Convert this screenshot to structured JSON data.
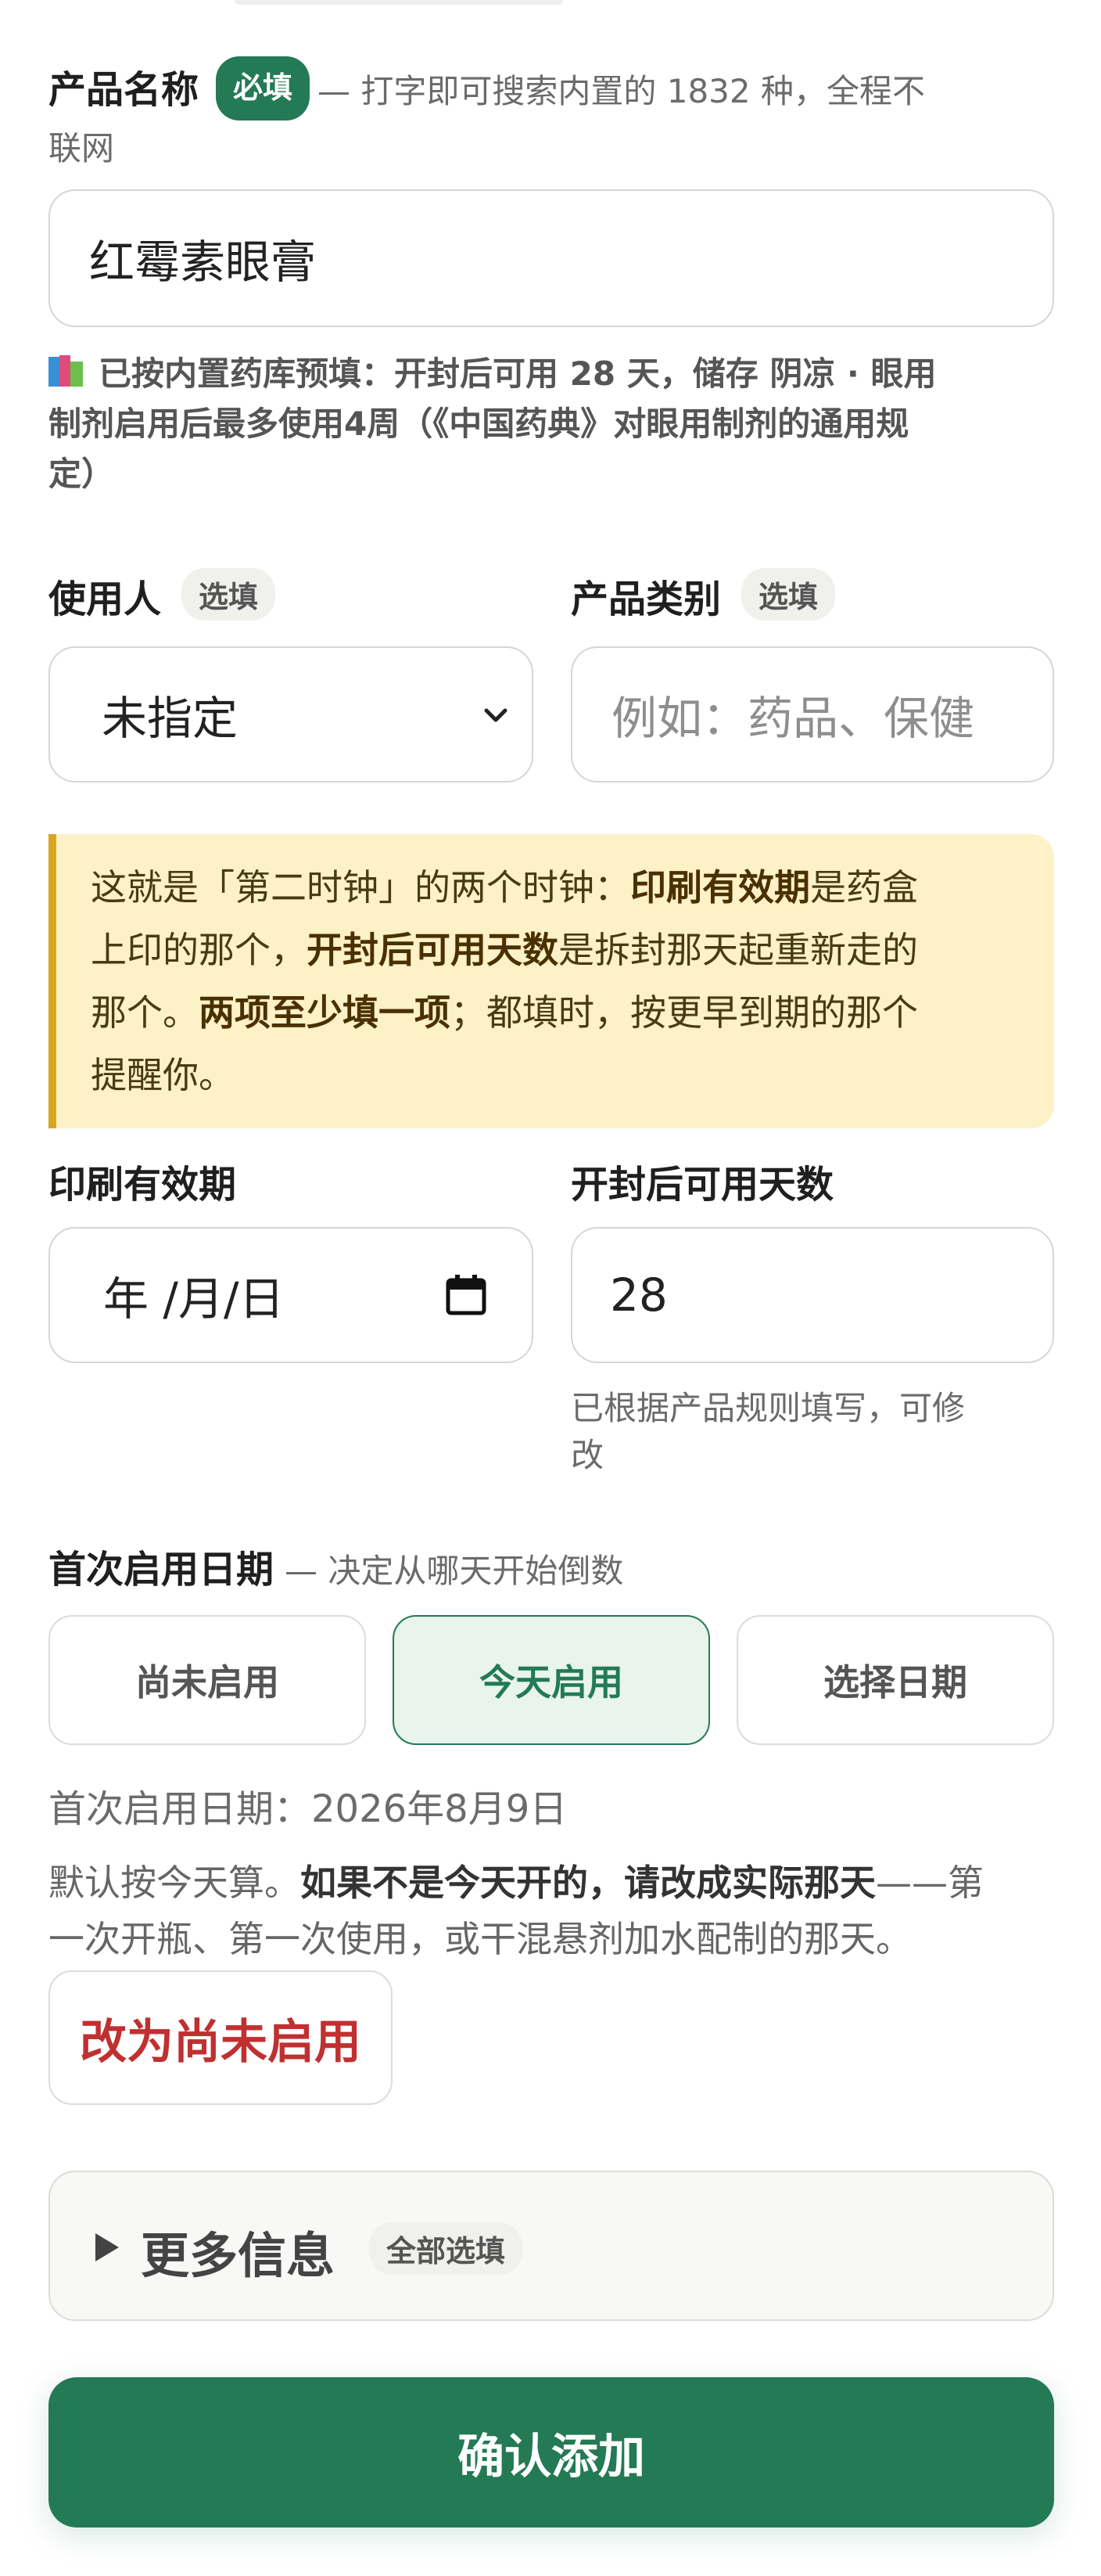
{
  "product_name": {
    "label": "产品名称",
    "required_badge": "必填",
    "hint_line1": "— 打字即可搜索内置的 1832 种，全程不",
    "hint_line2": "联网",
    "value": "红霉素眼膏",
    "prefill_note_line1": "已按内置药库预填：开封后可用 28 天，储存 阴凉 · 眼用",
    "prefill_note_line2": "制剂启用后最多使用4周（《中国药典》对眼用制剂的通用规",
    "prefill_note_line3": "定）"
  },
  "user": {
    "label": "使用人",
    "optional_badge": "选填",
    "selected": "未指定"
  },
  "category": {
    "label": "产品类别",
    "optional_badge": "选填",
    "placeholder": "例如：药品、保健"
  },
  "callout": {
    "line1_a": "这就是「第二时钟」的两个时钟：",
    "line1_b": "印刷有效期",
    "line1_c": "是药盒",
    "line2_a": "上印的那个，",
    "line2_b": "开封后可用天数",
    "line2_c": "是拆封那天起重新走的",
    "line3_a": "那个。",
    "line3_b": "两项至少填一项",
    "line3_c": "；都填时，按更早到期的那个",
    "line4": "提醒你。"
  },
  "printed_expiry": {
    "label": "印刷有效期",
    "placeholder": "年 /月/日"
  },
  "days_after_open": {
    "label": "开封后可用天数",
    "value": "28",
    "hint_line1": "已根据产品规则填写，可修",
    "hint_line2": "改"
  },
  "first_use": {
    "label": "首次启用日期",
    "hint": "— 决定从哪天开始倒数",
    "options": [
      "尚未启用",
      "今天启用",
      "选择日期"
    ],
    "selected_index": 1,
    "date_text": "首次启用日期：2026年8月9日",
    "note_a": "默认按今天算。",
    "note_b": "如果不是今天开的，请改成实际那天",
    "note_c": "——第",
    "note_line2": "一次开瓶、第一次使用，或干混悬剂加水配制的那天。",
    "reset_button": "改为尚未启用"
  },
  "more_info": {
    "label": "更多信息",
    "badge": "全部选填"
  },
  "submit_label": "确认添加",
  "colors": {
    "accent": "#237a55",
    "callout_bg": "#fdf1c8",
    "callout_border": "#d9a521",
    "danger": "#c03030"
  }
}
